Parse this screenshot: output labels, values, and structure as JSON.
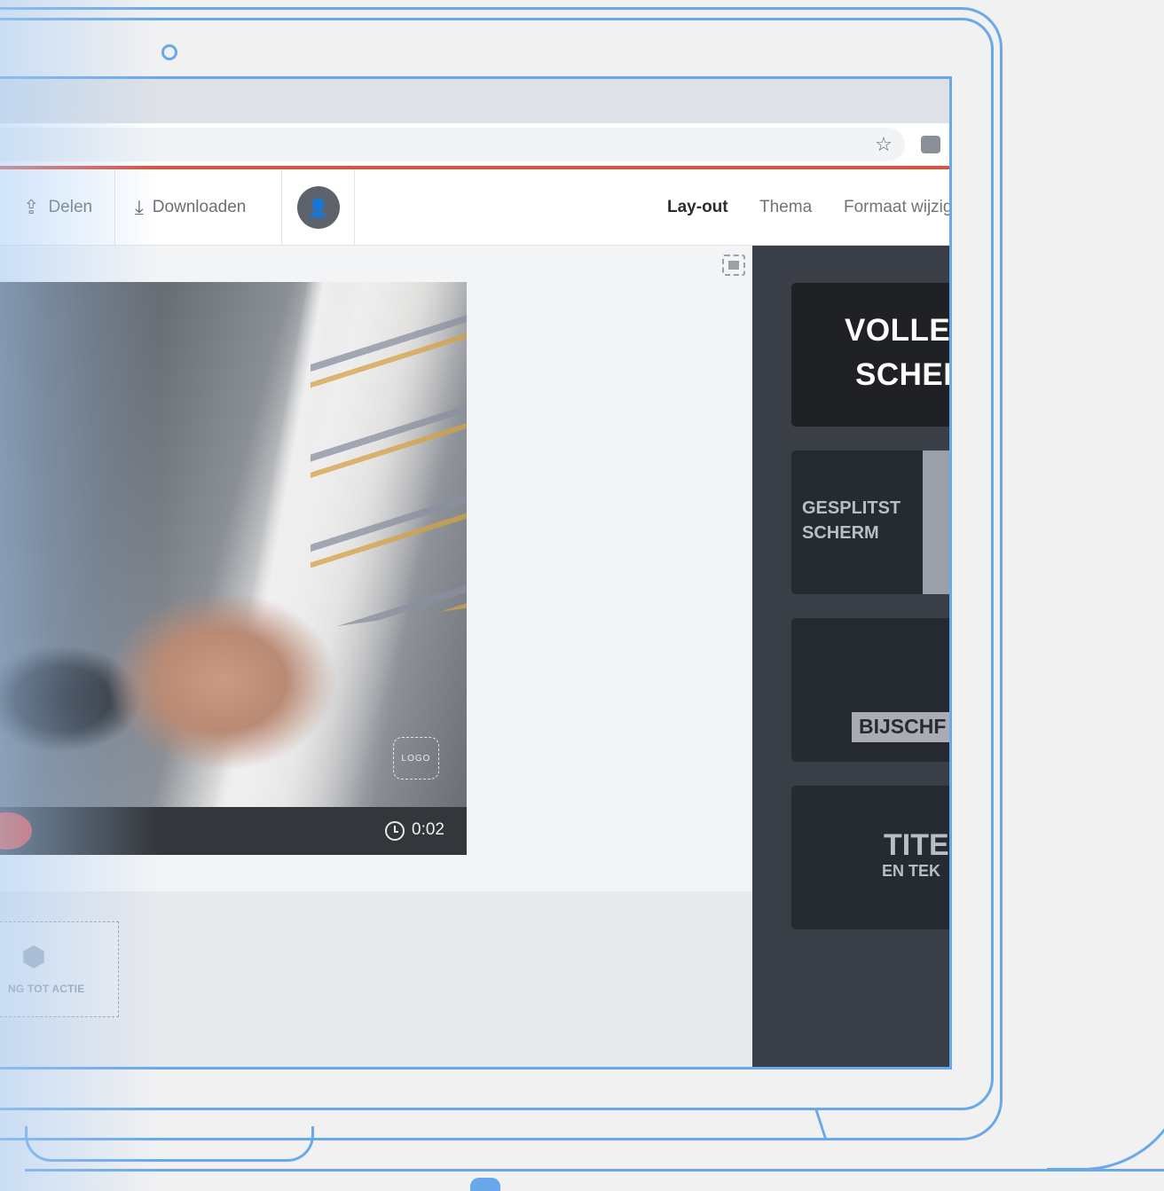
{
  "header": {
    "share_label": "Delen",
    "download_label": "Downloaden",
    "tabs": [
      {
        "label": "Lay-out",
        "active": true
      },
      {
        "label": "Thema",
        "active": false
      },
      {
        "label": "Formaat wijzig",
        "active": false
      }
    ]
  },
  "player": {
    "logo_placeholder": "LOGO",
    "time": "0:02"
  },
  "timeline": {
    "cta_label": "NG TOT ACTIE"
  },
  "layouts": {
    "full_screen": {
      "line1": "VOLLE",
      "line2": "SCHEI"
    },
    "split_screen": {
      "line1": "GESPLITST",
      "line2": "SCHERM"
    },
    "caption": {
      "label": "BIJSCHF"
    },
    "title": {
      "line1": "TITE",
      "line2": "EN TEK"
    }
  },
  "colors": {
    "accent_red": "#e0513a",
    "outline_blue": "#6aa8ec",
    "panel_dark": "#3a3e46"
  }
}
